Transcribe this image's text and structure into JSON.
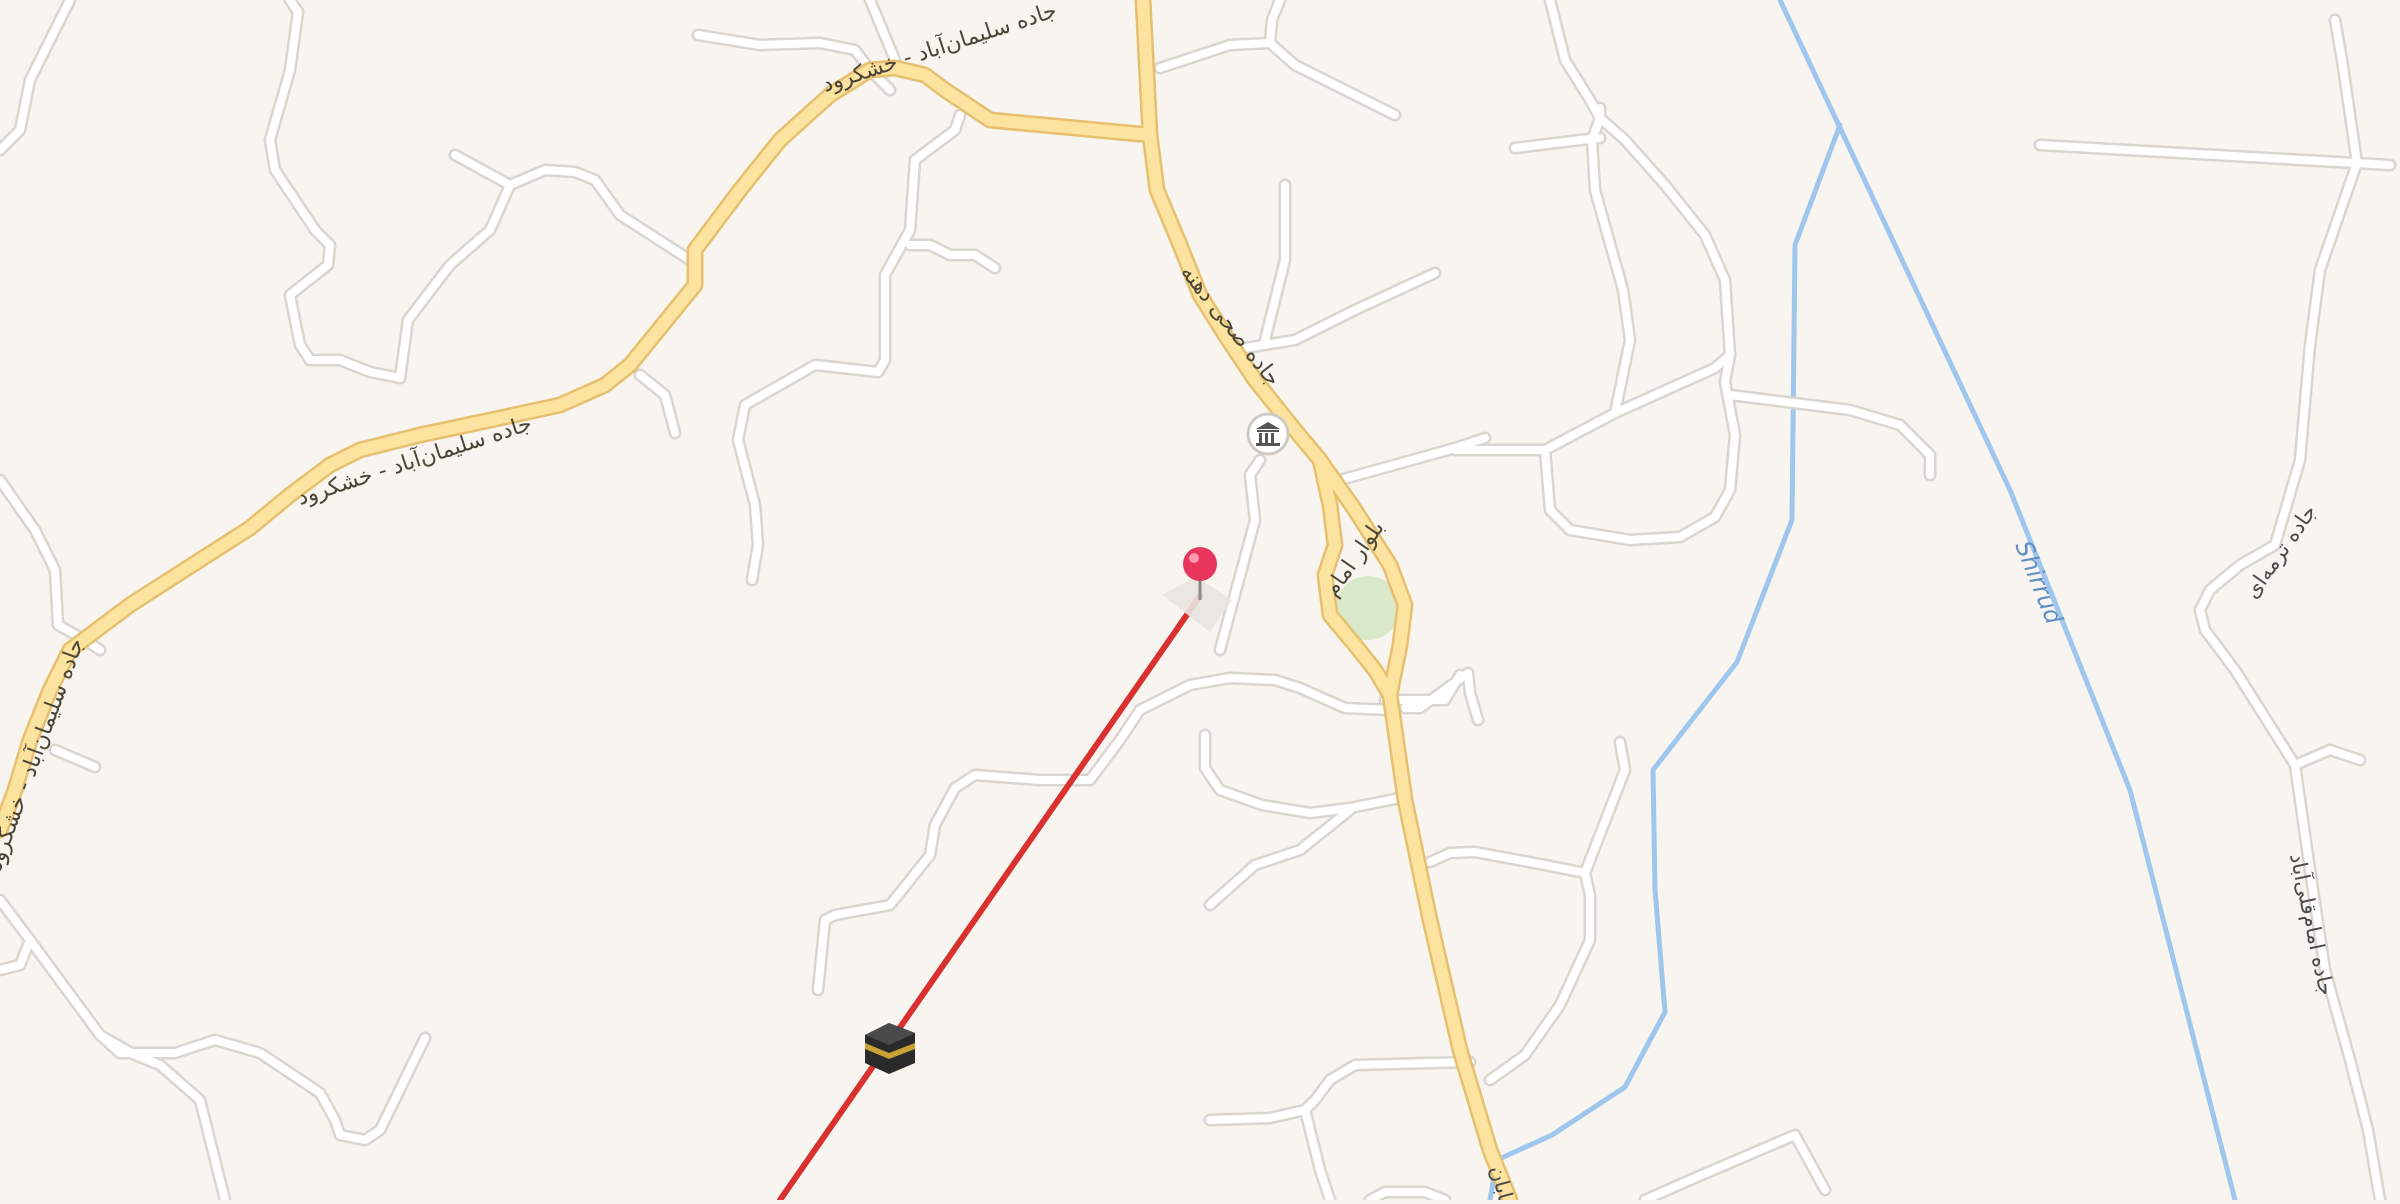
{
  "map": {
    "labels": {
      "main_road": "جاده سلیمان‌آباد - خشکرود",
      "main_road_end": "جاده سلیمان‌آباد - خشکرود",
      "side_road": "جاده صحی دهنه",
      "loop_road": "بلوار امام",
      "river": "Shirrud",
      "east_road_1": "جاده ترمه‌ای",
      "east_road_2": "جاده امام‌قلی‌آباد",
      "bottom_road": "خیابان"
    },
    "markers": [
      {
        "name": "dropped-pin",
        "color": "#e8355c"
      },
      {
        "name": "kaaba-icon",
        "label": "Kaaba direction"
      },
      {
        "name": "museum-icon",
        "label": "Museum"
      }
    ],
    "qibla_line_color": "#d93030",
    "colors": {
      "background": "#f8f5f1",
      "major_road": "#fde3a0",
      "major_road_casing": "#e8c16e",
      "minor_road": "#ffffff",
      "minor_road_casing": "#dcdad6",
      "river": "#9fc6ec",
      "park": "#d8e8c8"
    }
  }
}
